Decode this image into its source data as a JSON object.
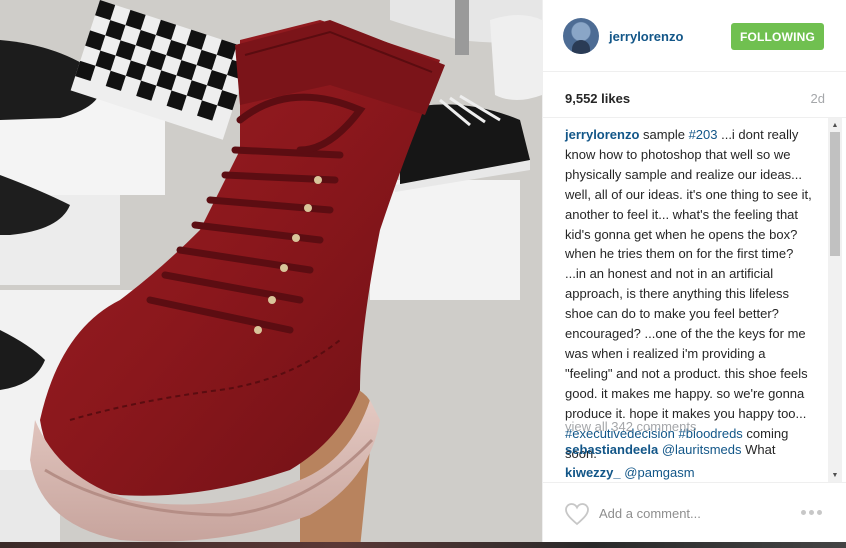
{
  "post": {
    "photo_icon": "sneaker-photo",
    "username": "jerrylorenzo",
    "follow_label": "FOLLOWING",
    "likes": "9,552 likes",
    "time_ago": "2d",
    "caption": {
      "author": "jerrylorenzo",
      "text_before": " sample ",
      "tag1": "#203",
      "text_middle": " ...i dont really know how to photoshop that well so we physically sample and realize our ideas... well, all of our ideas. it's one thing to see it, another to feel it... what's the feeling that kid's gonna get when he opens the box? when he tries them on for the first time? ...in an honest and not in an artificial approach, is there anything this lifeless shoe can do to make you feel better? encouraged? ...one of the the keys for me was when i realized i'm providing a \"feeling\" and not a product. this shoe feels good. it makes me happy. so we're gonna produce it. hope it makes you happy too... ",
      "tag2": "#executivedecision",
      "tag3": "#bloodreds",
      "text_end": " coming soon."
    },
    "view_all": "view all 342 comments",
    "comments": [
      {
        "user": "sebastiandeela",
        "mention": "@lauritsmeds",
        "text": " What"
      },
      {
        "user": "kiwezzy_",
        "mention": "@pamgasm",
        "text": ""
      }
    ],
    "comment_placeholder": "Add a comment...",
    "colors": {
      "link": "#125688",
      "follow": "#70c050",
      "muted": "#a5a7aa"
    },
    "icons": [
      "heart-icon",
      "more-options-icon",
      "scroll-up-arrow",
      "scroll-down-arrow"
    ]
  }
}
